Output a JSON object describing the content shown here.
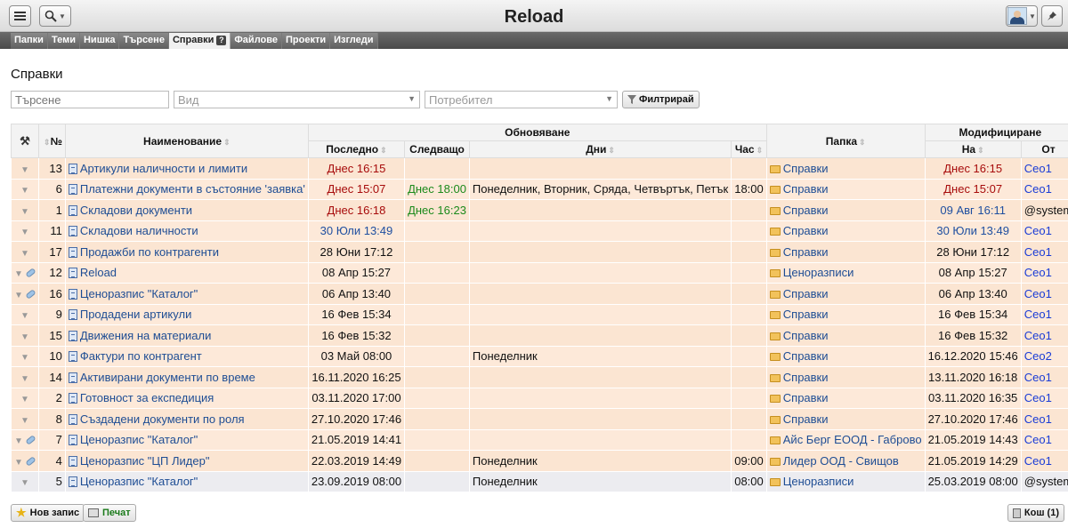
{
  "app": {
    "title": "Reload"
  },
  "tabs": [
    {
      "label": "Папки",
      "active": false
    },
    {
      "label": "Теми",
      "active": false
    },
    {
      "label": "Нишка",
      "active": false
    },
    {
      "label": "Търсене",
      "active": false
    },
    {
      "label": "Справки",
      "active": true
    },
    {
      "label": "Файлове",
      "active": false
    },
    {
      "label": "Проекти",
      "active": false
    },
    {
      "label": "Изгледи",
      "active": false
    }
  ],
  "tab_help_badge": "?",
  "page": {
    "title": "Справки"
  },
  "filters": {
    "search_placeholder": "Търсене",
    "type_placeholder": "Вид",
    "user_placeholder": "Потребител",
    "filter_button": "Филтрирай"
  },
  "table": {
    "headers": {
      "number": "№",
      "name": "Наименование",
      "update_group": "Обновяване",
      "last": "Последно",
      "next": "Следващо",
      "days": "Дни",
      "hour": "Час",
      "folder": "Папка",
      "modified_group": "Модифициране",
      "on": "На",
      "by": "От"
    },
    "rows": [
      {
        "num": "13",
        "name": "Артикули наличности и лимити",
        "last": "Днес 16:15",
        "last_color": "red",
        "next": "",
        "days": "",
        "hour": "",
        "folder": "Справки",
        "on": "Днес 16:15",
        "on_color": "red",
        "by": "Ceo1",
        "extra_icon": false
      },
      {
        "num": "6",
        "name": "Платежни документи в състояние 'заявка'",
        "last": "Днес 15:07",
        "last_color": "red",
        "next": "Днес 18:00",
        "days": "Понеделник, Вторник, Сряда, Четвъртък, Петък",
        "hour": "18:00",
        "folder": "Справки",
        "on": "Днес 15:07",
        "on_color": "red",
        "by": "Ceo1",
        "extra_icon": false
      },
      {
        "num": "1",
        "name": "Складови документи",
        "last": "Днес 16:18",
        "last_color": "red",
        "next": "Днес 16:23",
        "days": "",
        "hour": "",
        "folder": "Справки",
        "on": "09 Авг 16:11",
        "on_color": "blue",
        "by": "@system",
        "extra_icon": false
      },
      {
        "num": "11",
        "name": "Складови наличности",
        "last": "30 Юли 13:49",
        "last_color": "blue",
        "next": "",
        "days": "",
        "hour": "",
        "folder": "Справки",
        "on": "30 Юли 13:49",
        "on_color": "blue",
        "by": "Ceo1",
        "extra_icon": false
      },
      {
        "num": "17",
        "name": "Продажби по контрагенти",
        "last": "28 Юни 17:12",
        "last_color": "black",
        "next": "",
        "days": "",
        "hour": "",
        "folder": "Справки",
        "on": "28 Юни 17:12",
        "on_color": "black",
        "by": "Ceo1",
        "extra_icon": false
      },
      {
        "num": "12",
        "name": "Reload",
        "last": "08 Апр 15:27",
        "last_color": "black",
        "next": "",
        "days": "",
        "hour": "",
        "folder": "Ценоразписи",
        "on": "08 Апр 15:27",
        "on_color": "black",
        "by": "Ceo1",
        "extra_icon": true
      },
      {
        "num": "16",
        "name": "Ценоразпис \"Каталог\"",
        "last": "06 Апр 13:40",
        "last_color": "black",
        "next": "",
        "days": "",
        "hour": "",
        "folder": "Справки",
        "on": "06 Апр 13:40",
        "on_color": "black",
        "by": "Ceo1",
        "extra_icon": true
      },
      {
        "num": "9",
        "name": "Продадени артикули",
        "last": "16 Фев 15:34",
        "last_color": "black",
        "next": "",
        "days": "",
        "hour": "",
        "folder": "Справки",
        "on": "16 Фев 15:34",
        "on_color": "black",
        "by": "Ceo1",
        "extra_icon": false
      },
      {
        "num": "15",
        "name": "Движения на материали",
        "last": "16 Фев 15:32",
        "last_color": "black",
        "next": "",
        "days": "",
        "hour": "",
        "folder": "Справки",
        "on": "16 Фев 15:32",
        "on_color": "black",
        "by": "Ceo1",
        "extra_icon": false
      },
      {
        "num": "10",
        "name": "Фактури по контрагент",
        "last": "03 Май 08:00",
        "last_color": "black",
        "next": "",
        "days": "Понеделник",
        "hour": "",
        "folder": "Справки",
        "on": "16.12.2020 15:46",
        "on_color": "black",
        "by": "Ceo2",
        "extra_icon": false
      },
      {
        "num": "14",
        "name": "Активирани документи по време",
        "last": "16.11.2020 16:25",
        "last_color": "black",
        "next": "",
        "days": "",
        "hour": "",
        "folder": "Справки",
        "on": "13.11.2020 16:18",
        "on_color": "black",
        "by": "Ceo1",
        "extra_icon": false
      },
      {
        "num": "2",
        "name": "Готовност за експедиция",
        "last": "03.11.2020 17:00",
        "last_color": "black",
        "next": "",
        "days": "",
        "hour": "",
        "folder": "Справки",
        "on": "03.11.2020 16:35",
        "on_color": "black",
        "by": "Ceo1",
        "extra_icon": false
      },
      {
        "num": "8",
        "name": "Създадени документи по роля",
        "last": "27.10.2020 17:46",
        "last_color": "black",
        "next": "",
        "days": "",
        "hour": "",
        "folder": "Справки",
        "on": "27.10.2020 17:46",
        "on_color": "black",
        "by": "Ceo1",
        "extra_icon": false
      },
      {
        "num": "7",
        "name": "Ценоразпис \"Каталог\"",
        "last": "21.05.2019 14:41",
        "last_color": "black",
        "next": "",
        "days": "",
        "hour": "",
        "folder": "Айс Берг ЕООД - Габрово",
        "on": "21.05.2019 14:43",
        "on_color": "black",
        "by": "Ceo1",
        "extra_icon": true
      },
      {
        "num": "4",
        "name": "Ценоразпис \"ЦП Лидер\"",
        "last": "22.03.2019 14:49",
        "last_color": "black",
        "next": "",
        "days": "Понеделник",
        "hour": "09:00",
        "folder": "Лидер ООД - Свищов",
        "on": "21.05.2019 14:29",
        "on_color": "black",
        "by": "Ceo1",
        "extra_icon": true
      },
      {
        "num": "5",
        "name": "Ценоразпис \"Каталог\"",
        "last": "23.09.2019 08:00",
        "last_color": "black",
        "next": "",
        "days": "Понеделник",
        "hour": "08:00",
        "folder": "Ценоразписи",
        "on": "25.03.2019 08:00",
        "on_color": "black",
        "by": "@system",
        "extra_icon": false
      }
    ]
  },
  "buttons": {
    "new_record": "Нов запис",
    "print": "Печат",
    "trash": "Кош (1)"
  },
  "colors": {
    "row_bg": "#fbe5d2",
    "accent_red": "#a70b0b",
    "accent_green": "#1c8a1c",
    "link_blue": "#1e4d94",
    "tab_bar": "#555555"
  },
  "icons": [
    "menu-icon",
    "search-icon",
    "avatar",
    "pin-icon",
    "tools-icon",
    "document-icon",
    "folder-icon",
    "star-icon",
    "printer-icon",
    "trash-icon"
  ]
}
